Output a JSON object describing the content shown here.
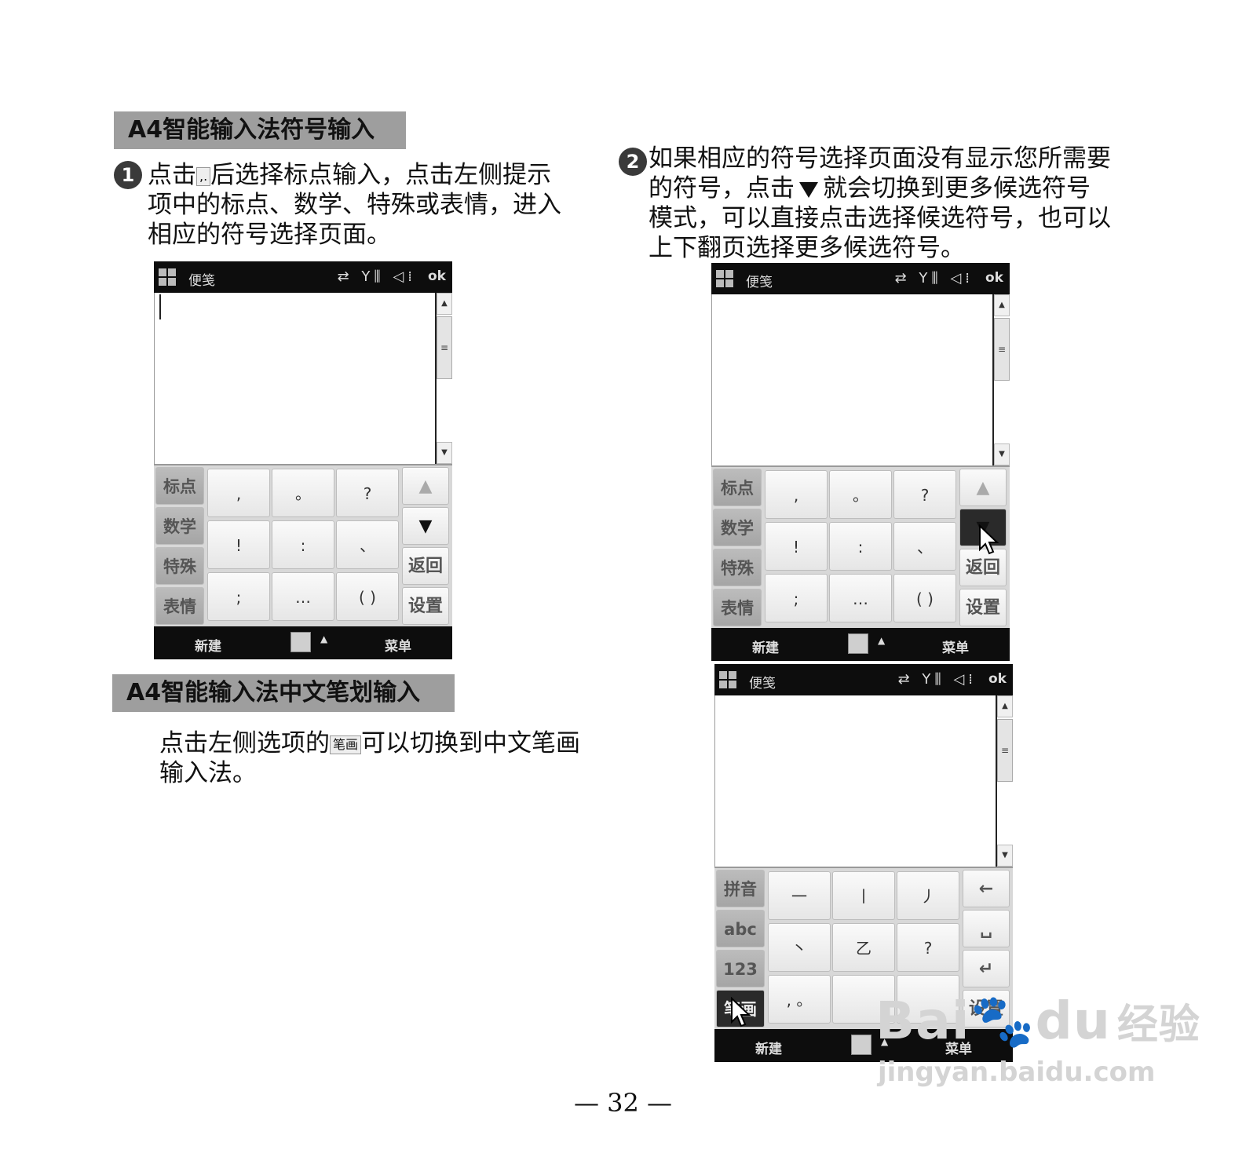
{
  "left": {
    "heading1": "A4智能输入法符号输入",
    "step1_num": "1",
    "step1_pre": "点击",
    "step1_icon": ",.",
    "step1_rest": "后选择标点输入，点击左侧提示",
    "step1_line2": "项中的标点、数学、特殊或表情，进入",
    "step1_line3": "相应的符号选择页面。",
    "heading2": "A4智能输入法中文笔划输入",
    "para2_pre": "点击左侧选项的",
    "para2_icon": "笔画",
    "para2_rest": "可以切换到中文笔画",
    "para2_line2": "输入法。"
  },
  "right": {
    "step2_num": "2",
    "line1": "如果相应的符号选择页面没有显示您所需要",
    "line2_pre": "的符号，点击",
    "line2_post": "就会切换到更多候选符号",
    "line3": "模式，可以直接点击选择候选符号，也可以",
    "line4": "上下翻页选择更多候选符号。"
  },
  "phone": {
    "app_title": "便笺",
    "status_icons": "⇄ Y⫼ ◁⁞",
    "ok": "ok",
    "bottom_left": "新建",
    "bottom_right": "菜单",
    "bottom_caret": "▲"
  },
  "symbol_keypad": {
    "side": [
      "标点",
      "数学",
      "特殊",
      "表情"
    ],
    "grid": [
      ",",
      "。",
      "?",
      "!",
      ":",
      "、",
      ";",
      "…",
      "( )"
    ],
    "right": [
      "▲",
      "▼",
      "返回",
      "设置"
    ]
  },
  "stroke_keypad": {
    "side": [
      "拼音",
      "abc",
      "123",
      "笔画"
    ],
    "grid": [
      "一",
      "丨",
      "丿",
      "丶",
      "乙",
      "?",
      ", 。",
      "",
      ""
    ],
    "right": [
      "←",
      "␣",
      "↵",
      "设置"
    ]
  },
  "watermark": {
    "brand": "Bai",
    "brand2": "du",
    "brand3": "经验",
    "url": "jingyan.baidu.com"
  },
  "page_number": "— 32 —"
}
